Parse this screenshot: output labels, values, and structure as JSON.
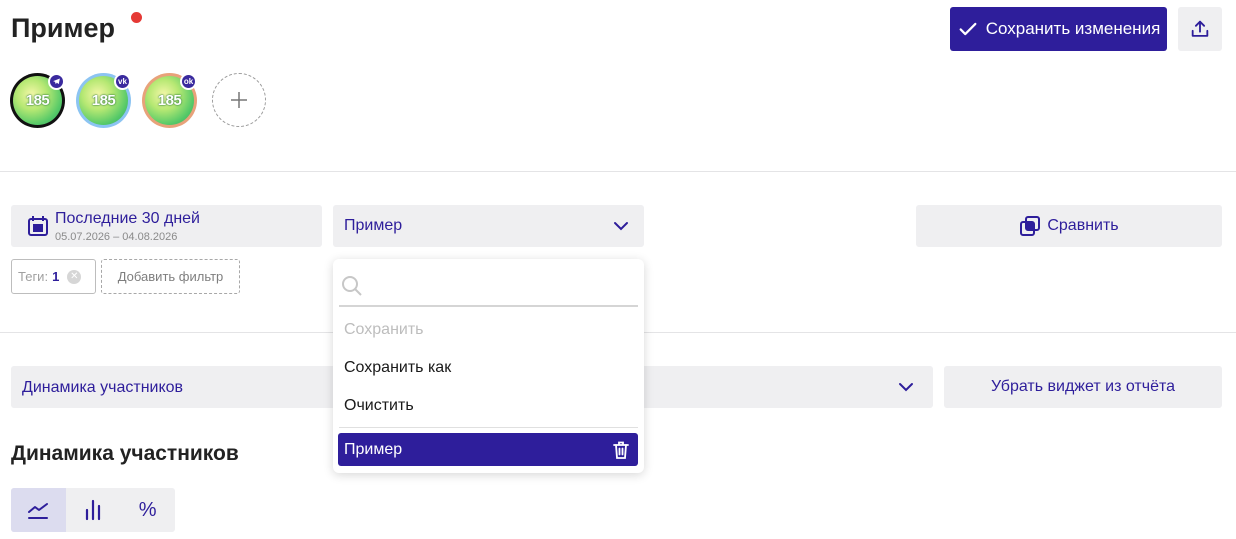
{
  "header": {
    "title": "Пример",
    "save_label": "Сохранить изменения",
    "status_color": "#e53935",
    "accent_color": "#2e1e9b"
  },
  "avatars": [
    {
      "label": "185",
      "network": "telegram",
      "ring_color": "#111111",
      "badge": "tg"
    },
    {
      "label": "185",
      "network": "vk",
      "ring_color": "#8cc4f2",
      "badge": "vk"
    },
    {
      "label": "185",
      "network": "ok",
      "ring_color": "#e8a27a",
      "badge": "ok"
    }
  ],
  "filters": {
    "date_label": "Последние 30 дней",
    "date_range": "05.07.2026 – 04.08.2026",
    "preset_value": "Пример",
    "compare_label": "Сравнить",
    "tag_label": "Теги:",
    "tag_count": "1",
    "add_filter_label": "Добавить фильтр"
  },
  "dropdown": {
    "search_placeholder": "",
    "items": [
      "Сохранить",
      "Сохранить как",
      "Очистить"
    ],
    "selected": "Пример"
  },
  "widget": {
    "select_value": "Динамика участников",
    "remove_label": "Убрать виджет из отчёта",
    "section_title": "Динамика участников",
    "chart_modes": [
      "line-chart-icon",
      "bar-chart-icon",
      "percent-icon"
    ],
    "active_mode": "line-chart-icon",
    "percent_glyph": "%"
  }
}
